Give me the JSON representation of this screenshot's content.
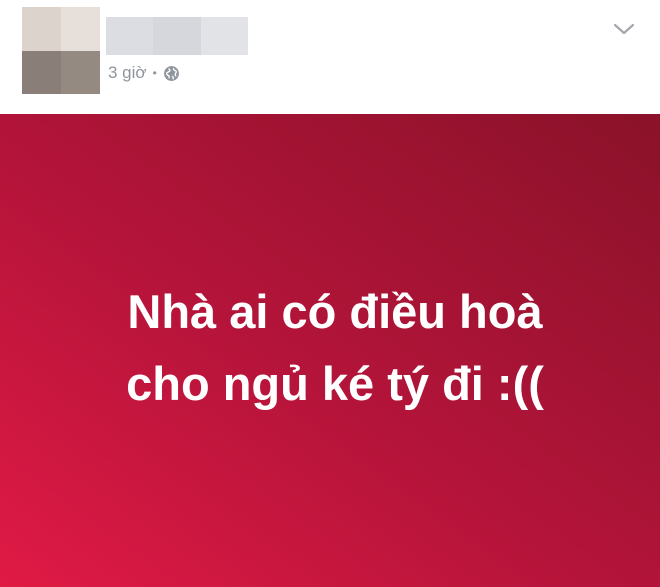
{
  "post": {
    "timestamp": "3 giờ",
    "separator": "•",
    "privacy_icon": "globe-icon",
    "menu_icon": "chevron-down-icon",
    "status_lines": [
      "Nhà ai có điều hoà",
      "cho ngủ ké tý đi :(("
    ],
    "colors": {
      "banner_gradient_start": "#e01a45",
      "banner_gradient_end": "#8a1229",
      "text": "#ffffff",
      "meta_text": "#90949c"
    }
  }
}
